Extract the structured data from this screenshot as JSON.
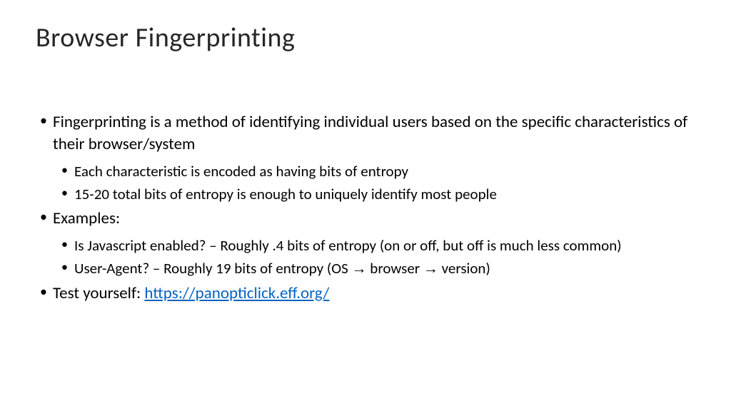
{
  "title": "Browser Fingerprinting",
  "bullets": {
    "b1": "Fingerprinting is a method of identifying individual users based on the specific characteristics of their browser/system",
    "b1_1": "Each characteristic is encoded as having bits of entropy",
    "b1_2": "15-20 total bits of entropy is enough to uniquely identify most people",
    "b2": "Examples:",
    "b2_1": "Is Javascript enabled? – Roughly .4 bits of entropy (on or off, but off is much less common)",
    "b2_2_pre": "User-Agent? – Roughly 19 bits of entropy (OS ",
    "b2_2_mid": " browser ",
    "b2_2_post": " version)",
    "arrow": "→",
    "b3_pre": "Test yourself: ",
    "b3_link": "https://panopticlick.eff.org/"
  }
}
